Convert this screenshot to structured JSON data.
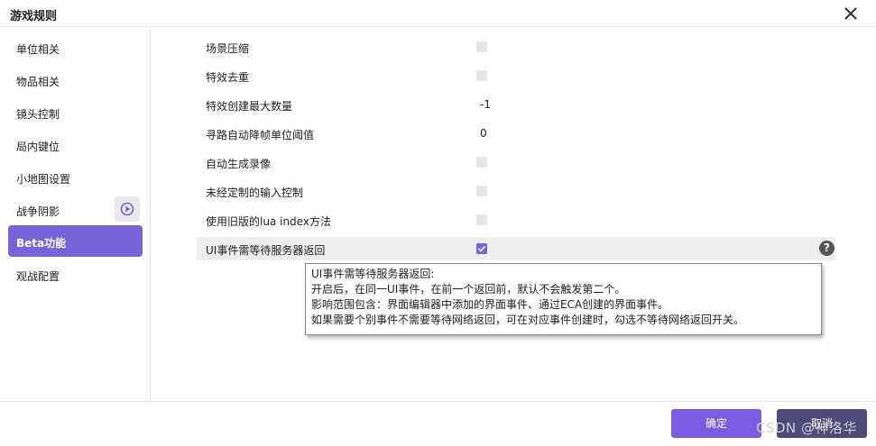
{
  "dialog": {
    "title": "游戏规则"
  },
  "sidebar": {
    "items": [
      {
        "label": "单位相关"
      },
      {
        "label": "物品相关"
      },
      {
        "label": "镜头控制"
      },
      {
        "label": "局内键位"
      },
      {
        "label": "小地图设置"
      },
      {
        "label": "战争阴影"
      },
      {
        "label": "Beta功能",
        "active": true
      },
      {
        "label": "观战配置"
      }
    ]
  },
  "settings": {
    "rows": [
      {
        "label": "场景压缩",
        "type": "checkbox",
        "checked": false
      },
      {
        "label": "特效去重",
        "type": "checkbox",
        "checked": false
      },
      {
        "label": "特效创建最大数量",
        "type": "value",
        "value": "-1"
      },
      {
        "label": "寻路自动降帧单位阈值",
        "type": "value",
        "value": "0"
      },
      {
        "label": "自动生成录像",
        "type": "checkbox",
        "checked": false
      },
      {
        "label": "未经定制的输入控制",
        "type": "checkbox",
        "checked": false
      },
      {
        "label": "使用旧版的lua index方法",
        "type": "checkbox",
        "checked": false
      },
      {
        "label": "UI事件需等待服务器返回",
        "type": "checkbox",
        "checked": true
      }
    ]
  },
  "tooltip": {
    "lines": [
      "UI事件需等待服务器返回:",
      "开启后，在同一UI事件，在前一个返回前，默认不会触发第二个。",
      "影响范围包含：界面编辑器中添加的界面事件、通过ECA创建的界面事件。",
      "如果需要个别事件不需要等待网络返回，可在对应事件创建时，勾选不等待网络返回开关。"
    ]
  },
  "help_icon_glyph": "?",
  "footer": {
    "ok_label": "确定",
    "cancel_label": "取消",
    "watermark": "CSDN @神洛华"
  },
  "colors": {
    "accent": "#7565d8",
    "ok_button": "#7b5ce0",
    "cancel_button": "#4e4a7a"
  }
}
